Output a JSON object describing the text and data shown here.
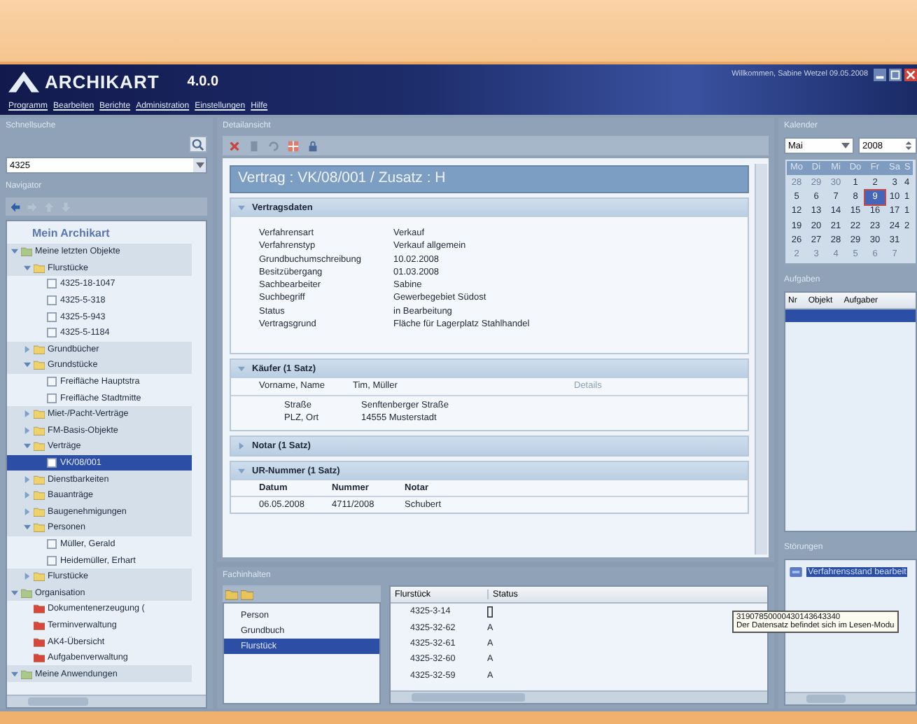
{
  "header": {
    "logo": "ARCHIKART",
    "version": "4.0.0",
    "greeting": "Willkommen, Sabine Wetzel 09.05.2008"
  },
  "menu": [
    "Programm",
    "Bearbeiten",
    "Berichte",
    "Administration",
    "Einstellungen",
    "Hilfe"
  ],
  "quick_search": {
    "title": "Schnellsuche",
    "value": "4325"
  },
  "navigator": {
    "title": "Navigator",
    "heading": "Mein Archikart",
    "tree": [
      {
        "label": "Meine letzten Objekte",
        "kind": "group",
        "expanded": true,
        "selected": false,
        "children": [
          {
            "label": "Flurstücke",
            "kind": "folder",
            "expanded": true,
            "selected": false,
            "children": [
              {
                "label": "4325-18-1047",
                "kind": "record",
                "selected": false
              },
              {
                "label": "4325-5-318",
                "kind": "record",
                "selected": false
              },
              {
                "label": "4325-5-943",
                "kind": "record",
                "selected": false
              },
              {
                "label": "4325-5-1184",
                "kind": "record",
                "selected": false
              }
            ]
          },
          {
            "label": "Grundbücher",
            "kind": "folder",
            "expanded": false,
            "selected": false
          },
          {
            "label": "Grundstücke",
            "kind": "folder",
            "expanded": true,
            "selected": false,
            "children": [
              {
                "label": "Freifläche Hauptstra",
                "kind": "record",
                "selected": false
              },
              {
                "label": "Freifläche Stadtmitte",
                "kind": "record",
                "selected": false
              }
            ]
          },
          {
            "label": "Miet-/Pacht-Verträge",
            "kind": "folder",
            "expanded": false,
            "selected": false
          },
          {
            "label": "FM-Basis-Objekte",
            "kind": "folder",
            "expanded": false,
            "selected": false
          },
          {
            "label": "Verträge",
            "kind": "folder",
            "expanded": true,
            "selected": false,
            "children": [
              {
                "label": "VK/08/001",
                "kind": "record",
                "selected": true
              }
            ]
          },
          {
            "label": "Dienstbarkeiten",
            "kind": "folder",
            "expanded": false,
            "selected": false
          },
          {
            "label": "Bauanträge",
            "kind": "folder",
            "expanded": false,
            "selected": false
          },
          {
            "label": "Baugenehmigungen",
            "kind": "folder",
            "expanded": false,
            "selected": false
          },
          {
            "label": "Personen",
            "kind": "folder",
            "expanded": true,
            "selected": false,
            "children": [
              {
                "label": "Müller, Gerald",
                "kind": "record",
                "selected": false
              },
              {
                "label": "Heidemüller, Erhart",
                "kind": "record",
                "selected": false
              }
            ]
          },
          {
            "label": "Flurstücke",
            "kind": "folder",
            "expanded": false,
            "selected": false
          }
        ]
      },
      {
        "label": "Organisation",
        "kind": "group",
        "expanded": true,
        "selected": false,
        "children": [
          {
            "label": "Dokumentenerzeugung (",
            "kind": "app",
            "selected": false
          },
          {
            "label": "Terminverwaltung",
            "kind": "app",
            "selected": false
          },
          {
            "label": "AK4-Übersicht",
            "kind": "app",
            "selected": false
          },
          {
            "label": "Aufgabenverwaltung",
            "kind": "app",
            "selected": false
          }
        ]
      },
      {
        "label": "Meine Anwendungen",
        "kind": "group",
        "expanded": true,
        "selected": false
      }
    ]
  },
  "detail": {
    "title": "Detailansicht",
    "record_title": "Vertrag : VK/08/001 / Zusatz : H",
    "sections": [
      {
        "kind": "fields",
        "title": "Vertragsdaten",
        "expanded": true,
        "fields": [
          {
            "label": "Verfahrensart",
            "value": "Verkauf"
          },
          {
            "label": "Verfahrenstyp",
            "value": "Verkauf allgemein"
          },
          {
            "label": "Grundbuchumschreibung",
            "value": "10.02.2008"
          },
          {
            "label": "Besitzübergang",
            "value": "01.03.2008"
          },
          {
            "label": "Sachbearbeiter",
            "value": "Sabine"
          },
          {
            "label": "Suchbegriff",
            "value": "Gewerbegebiet Südost"
          },
          {
            "label": "Status",
            "value": "in Bearbeitung"
          },
          {
            "label": "Vertragsgrund",
            "value": "Fläche für Lagerplatz Stahlhandel"
          }
        ]
      },
      {
        "kind": "person",
        "title": "Käufer (1 Satz)",
        "expanded": true,
        "name_label": "Vorname, Name",
        "name": "Tim, Müller",
        "link": "Details",
        "fields": [
          {
            "label": "Straße",
            "value": "Senftenberger Straße"
          },
          {
            "label": "PLZ, Ort",
            "value": "14555 Musterstadt"
          }
        ]
      },
      {
        "kind": "fields",
        "title": "Notar (1 Satz)",
        "expanded": false
      },
      {
        "kind": "table",
        "title": "UR-Nummer (1 Satz)",
        "expanded": true,
        "columns": [
          "Datum",
          "Nummer",
          "Notar"
        ],
        "rows": [
          [
            "06.05.2008",
            "4711/2008",
            "Schubert"
          ]
        ]
      }
    ]
  },
  "fach": {
    "title": "Fachinhalten",
    "types": [
      {
        "label": "Person",
        "selected": false
      },
      {
        "label": "Grundbuch",
        "selected": false
      },
      {
        "label": "Flurstück",
        "selected": true
      }
    ],
    "columns": [
      "Flurstück",
      "Status"
    ],
    "rows": [
      {
        "flurstueck": "4325-3-14",
        "kind": "box"
      },
      {
        "flurstueck": "4325-32-62",
        "kind": "text",
        "status": "A"
      },
      {
        "flurstueck": "4325-32-61",
        "kind": "text",
        "status": "A"
      },
      {
        "flurstueck": "4325-32-60",
        "kind": "text",
        "status": "A"
      },
      {
        "flurstueck": "4325-32-59",
        "kind": "text",
        "status": "A"
      }
    ]
  },
  "tooltip": {
    "lines": [
      "31907850000430143643340",
      "Der Datensatz befindet sich im Lesen-Modu"
    ]
  },
  "calendar": {
    "title": "Kalender",
    "month": "Mai",
    "year": "2008",
    "weekdays": [
      "Mo",
      "Di",
      "Mi",
      "Do",
      "Fr",
      "Sa",
      "S"
    ],
    "weeks": [
      [
        {
          "d": "28",
          "other": true
        },
        {
          "d": "29",
          "other": true
        },
        {
          "d": "30",
          "other": true
        },
        {
          "d": "1",
          "other": false
        },
        {
          "d": "2",
          "other": false
        },
        {
          "d": "3",
          "other": false
        },
        {
          "d": "4",
          "other": false
        }
      ],
      [
        {
          "d": "5",
          "other": false
        },
        {
          "d": "6",
          "other": false
        },
        {
          "d": "7",
          "other": false
        },
        {
          "d": "8",
          "other": false
        },
        {
          "d": "9",
          "other": false,
          "selected": true
        },
        {
          "d": "10",
          "other": false
        },
        {
          "d": "1",
          "other": false
        }
      ],
      [
        {
          "d": "12",
          "other": false
        },
        {
          "d": "13",
          "other": false
        },
        {
          "d": "14",
          "other": false
        },
        {
          "d": "15",
          "other": false
        },
        {
          "d": "16",
          "other": false
        },
        {
          "d": "17",
          "other": false
        },
        {
          "d": "1",
          "other": false
        }
      ],
      [
        {
          "d": "19",
          "other": false
        },
        {
          "d": "20",
          "other": false
        },
        {
          "d": "21",
          "other": false
        },
        {
          "d": "22",
          "other": false
        },
        {
          "d": "23",
          "other": false
        },
        {
          "d": "24",
          "other": false
        },
        {
          "d": "2",
          "other": false
        }
      ],
      [
        {
          "d": "26",
          "other": false
        },
        {
          "d": "27",
          "other": false
        },
        {
          "d": "28",
          "other": false
        },
        {
          "d": "29",
          "other": false
        },
        {
          "d": "30",
          "other": false
        },
        {
          "d": "31",
          "other": false
        }
      ],
      [
        {
          "d": "2",
          "other": true
        },
        {
          "d": "3",
          "other": true
        },
        {
          "d": "4",
          "other": true
        },
        {
          "d": "5",
          "other": true
        },
        {
          "d": "6",
          "other": true
        },
        {
          "d": "7",
          "other": true
        }
      ]
    ]
  },
  "tasks": {
    "title": "Aufgaben",
    "columns": [
      "Nr",
      "Objekt",
      "Aufgaber"
    ],
    "rows": [
      {
        "selected": true
      }
    ]
  },
  "faults": {
    "title": "Störungen",
    "items": [
      {
        "label": "Verfahrensstand bearbeit",
        "selected": true
      }
    ]
  }
}
